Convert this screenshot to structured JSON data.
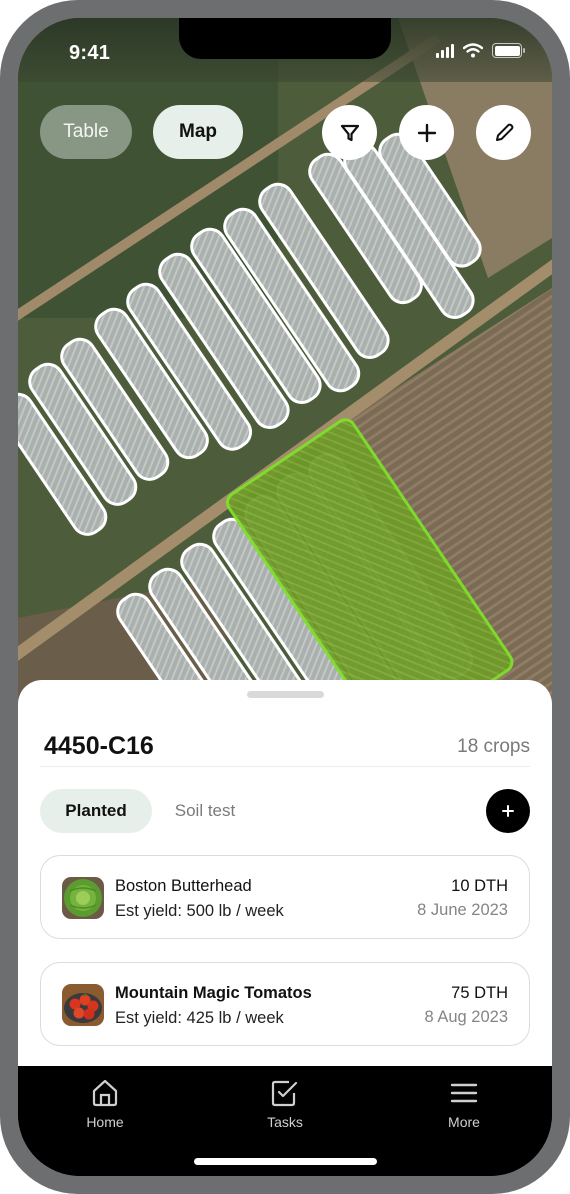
{
  "status_bar": {
    "time": "9:41"
  },
  "map_toolbar": {
    "view_toggle": [
      {
        "label": "Table",
        "active": false
      },
      {
        "label": "Map",
        "active": true
      }
    ],
    "actions": [
      {
        "icon": "filter-icon"
      },
      {
        "icon": "plus-icon"
      },
      {
        "icon": "pencil-icon"
      }
    ]
  },
  "map": {
    "selected_field_color": "#7ee02a",
    "outline_color": "#ffffff"
  },
  "sheet": {
    "field_name": "4450-C16",
    "crop_count": "18 crops",
    "tabs": [
      {
        "label": "Planted",
        "active": true
      },
      {
        "label": "Soil test",
        "active": false
      }
    ],
    "crops": [
      {
        "name": "Boston Butterhead",
        "yield": "Est yield: 500 lb / week",
        "dth": "10 DTH",
        "date": "8 June 2023",
        "thumb": "lettuce"
      },
      {
        "name": "Mountain Magic Tomatos",
        "yield": "Est yield: 425 lb / week",
        "dth": "75 DTH",
        "date": "8 Aug 2023",
        "thumb": "tomatoes"
      }
    ]
  },
  "tabbar": {
    "items": [
      {
        "label": "Home",
        "icon": "home-icon"
      },
      {
        "label": "Tasks",
        "icon": "tasks-checkbox-icon"
      },
      {
        "label": "More",
        "icon": "menu-icon"
      }
    ]
  }
}
